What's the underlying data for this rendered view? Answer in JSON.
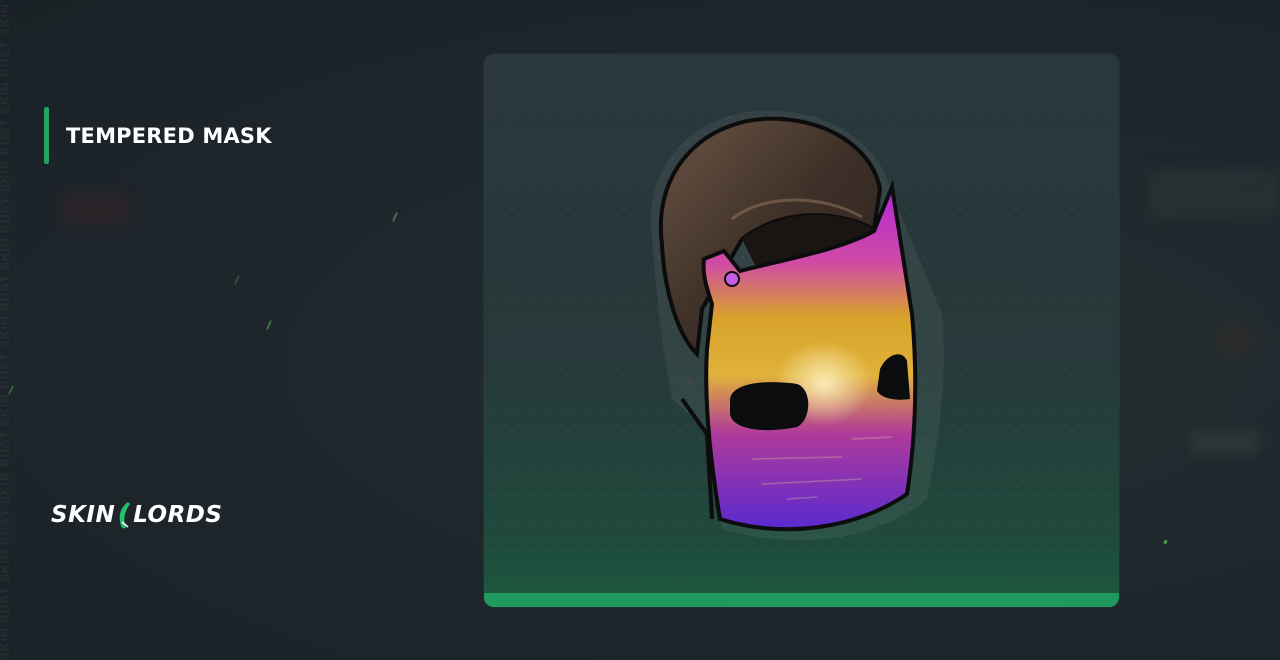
{
  "item": {
    "name": "TEMPERED MASK"
  },
  "brand": {
    "logo_left": "SKIN",
    "logo_right": "LORDS",
    "watermark": "SKIN RUST SKIN RUST SKIN RUST SKIN RUST SKIN RUST SKIN RUST SKIN RUST SKIN RUST SKIN RUST SKIN RUST"
  },
  "colors": {
    "accent": "#1fa463",
    "card_bar": "#1f9a5e",
    "background": "#1e262c"
  },
  "icons": {
    "logo_mark": "leaf-blade-icon",
    "item_image": "tempered-mask-image"
  }
}
